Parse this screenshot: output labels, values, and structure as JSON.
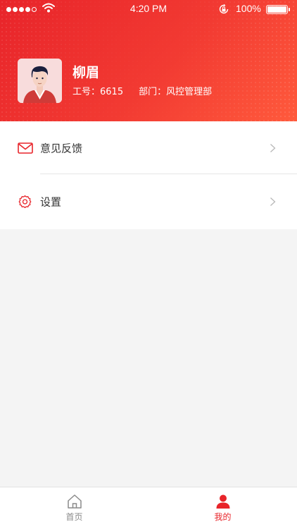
{
  "status_bar": {
    "time": "4:20 PM",
    "battery": "100%"
  },
  "profile": {
    "name": "柳眉",
    "employee_id": "工号：6615",
    "department": "部门：风控管理部"
  },
  "menu": [
    {
      "label": "意见反馈",
      "icon": "mail-icon"
    },
    {
      "label": "设置",
      "icon": "gear-icon"
    }
  ],
  "tabs": [
    {
      "label": "首页",
      "icon": "home-icon",
      "active": false
    },
    {
      "label": "我的",
      "icon": "user-icon",
      "active": true
    }
  ],
  "colors": {
    "accent": "#e8242a",
    "background": "#f4f4f4"
  }
}
